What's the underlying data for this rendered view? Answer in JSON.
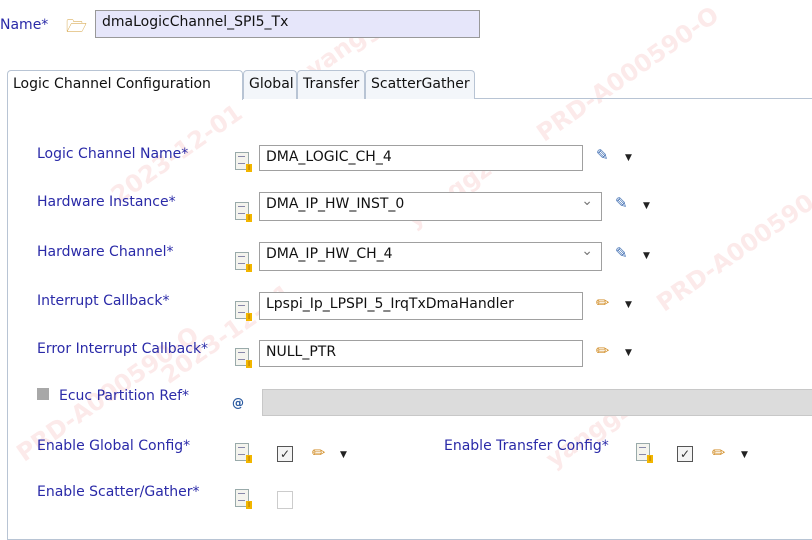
{
  "name_label": "Name*",
  "name_value": "dmaLogicChannel_SPI5_Tx",
  "tabs": [
    "Logic Channel Configuration",
    "Global",
    "Transfer",
    "ScatterGather"
  ],
  "fields": {
    "logic_channel_name": {
      "label": "Logic Channel Name*",
      "value": "DMA_LOGIC_CH_4"
    },
    "hardware_instance": {
      "label": "Hardware Instance*",
      "value": "DMA_IP_HW_INST_0"
    },
    "hardware_channel": {
      "label": "Hardware Channel*",
      "value": "DMA_IP_HW_CH_4"
    },
    "interrupt_callback": {
      "label": "Interrupt Callback*",
      "value": "Lpspi_Ip_LPSPI_5_IrqTxDmaHandler"
    },
    "error_interrupt_callback": {
      "label": "Error Interrupt Callback*",
      "value": "NULL_PTR"
    },
    "ecuc_partition_ref": {
      "label": "Ecuc Partition Ref*",
      "value": ""
    },
    "enable_global_config": {
      "label": "Enable Global Config*",
      "checked": true
    },
    "enable_transfer_config": {
      "label": "Enable Transfer Config*",
      "checked": true
    },
    "enable_scatter_gather": {
      "label": "Enable Scatter/Gather*",
      "checked": false
    }
  },
  "watermark": [
    "yanggz",
    "PRD-A000590-O",
    "2023-12-01"
  ]
}
